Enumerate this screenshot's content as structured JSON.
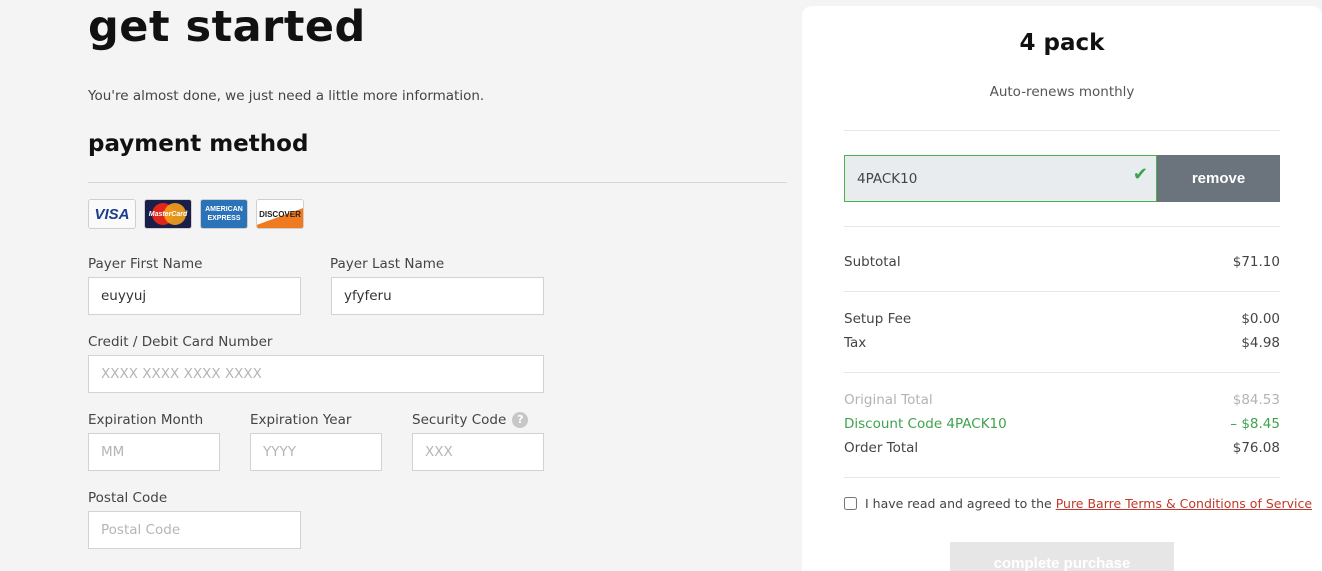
{
  "page": {
    "title": "get started",
    "subtitle": "You're almost done, we just need a little more information."
  },
  "payment": {
    "section_title": "payment method",
    "cards": [
      {
        "name": "visa-card-icon",
        "label": "VISA"
      },
      {
        "name": "mastercard-icon",
        "label": "MasterCard"
      },
      {
        "name": "amex-card-icon",
        "label": "AMERICAN EXPRESS"
      },
      {
        "name": "discover-card-icon",
        "label": "DISCOVER"
      }
    ],
    "first_name": {
      "label": "Payer First Name",
      "value": "euyyuj"
    },
    "last_name": {
      "label": "Payer Last Name",
      "value": "yfyferu"
    },
    "card_number": {
      "label": "Credit / Debit Card Number",
      "placeholder": "XXXX XXXX XXXX XXXX"
    },
    "exp_month": {
      "label": "Expiration Month",
      "placeholder": "MM"
    },
    "exp_year": {
      "label": "Expiration Year",
      "placeholder": "YYYY"
    },
    "security_code": {
      "label": "Security Code",
      "placeholder": "XXX",
      "help_icon": "?"
    },
    "postal_code": {
      "label": "Postal Code",
      "placeholder": "Postal Code"
    }
  },
  "summary": {
    "pack_title": "4 pack",
    "renewal": "Auto-renews monthly",
    "promo_code": "4PACK10",
    "remove_label": "remove",
    "subtotal": {
      "label": "Subtotal",
      "value": "$71.10"
    },
    "setup_fee": {
      "label": "Setup Fee",
      "value": "$0.00"
    },
    "tax": {
      "label": "Tax",
      "value": "$4.98"
    },
    "original_total": {
      "label": "Original Total",
      "value": "$84.53"
    },
    "discount": {
      "label": "Discount Code 4PACK10",
      "value": "– $8.45"
    },
    "order_total": {
      "label": "Order Total",
      "value": "$76.08"
    },
    "terms_text": "I have read and agreed to the",
    "terms_link": "Pure Barre Terms & Conditions of Service",
    "purchase_label": "complete purchase"
  },
  "colors": {
    "accent_green": "#3fa34d",
    "remove_button": "#6b747c",
    "link_red": "#c0392b"
  }
}
